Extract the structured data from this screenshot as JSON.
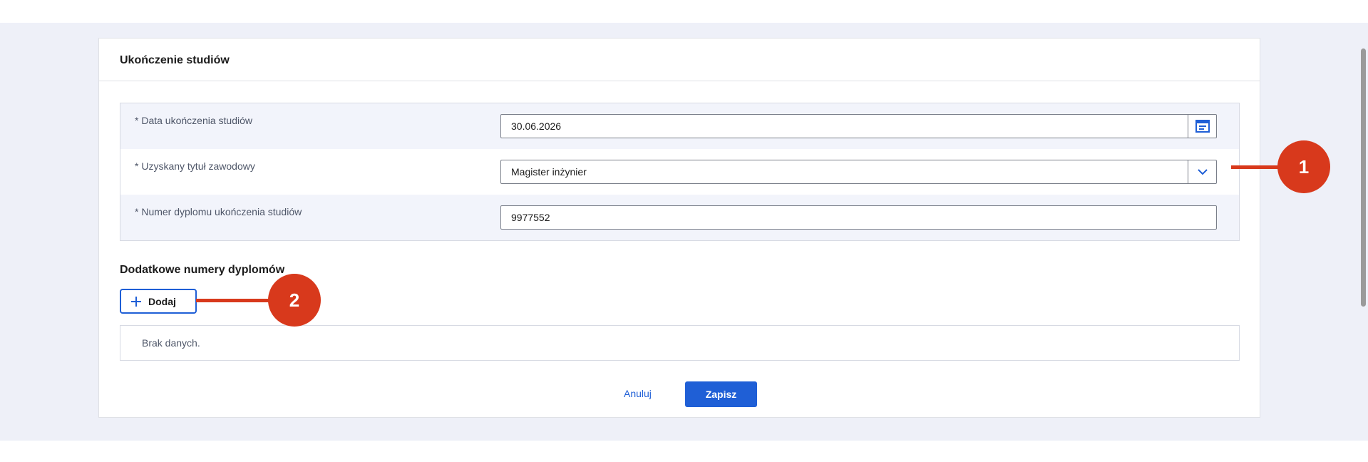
{
  "card": {
    "title": "Ukończenie studiów"
  },
  "form": {
    "rows": [
      {
        "label": "* Data ukończenia studiów",
        "value": "30.06.2026",
        "button_icon": "calendar-icon"
      },
      {
        "label": "* Uzyskany tytuł zawodowy",
        "value": "Magister inżynier",
        "button_icon": "chevron-down-icon"
      },
      {
        "label": "* Numer dyplomu ukończenia studiów",
        "value": "9977552"
      }
    ]
  },
  "additional": {
    "title": "Dodatkowe numery dyplomów",
    "add_label": "Dodaj",
    "empty_text": "Brak danych."
  },
  "actions": {
    "cancel_label": "Anuluj",
    "save_label": "Zapisz"
  },
  "callouts": {
    "first": "1",
    "second": "2"
  },
  "colors": {
    "accent": "#1f5fd6",
    "callout": "#d8391c",
    "background": "#eef0f8"
  }
}
